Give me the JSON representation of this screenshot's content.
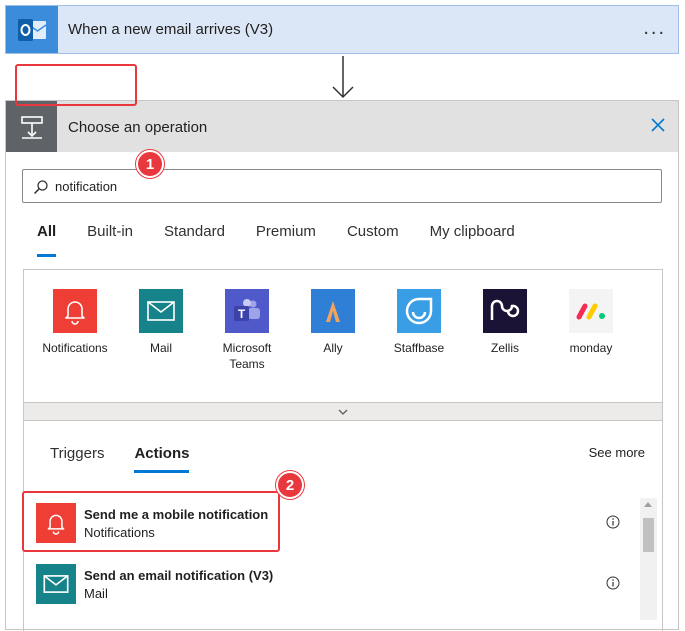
{
  "trigger": {
    "title": "When a new email arrives (V3)",
    "icon": "outlook-icon",
    "menu": "..."
  },
  "operation_panel": {
    "title": "Choose an operation",
    "search": {
      "value": "notification",
      "placeholder": ""
    },
    "tabs": [
      {
        "label": "All",
        "active": true
      },
      {
        "label": "Built-in",
        "active": false
      },
      {
        "label": "Standard",
        "active": false
      },
      {
        "label": "Premium",
        "active": false
      },
      {
        "label": "Custom",
        "active": false
      },
      {
        "label": "My clipboard",
        "active": false
      }
    ],
    "connectors": [
      {
        "label": "Notifications",
        "icon": "bell-icon",
        "color": "#ef3e36"
      },
      {
        "label": "Mail",
        "icon": "envelope-icon",
        "color": "#16838a"
      },
      {
        "label": "Microsoft Teams",
        "icon": "teams-icon",
        "color": "#5059c9"
      },
      {
        "label": "Ally",
        "icon": "ally-icon",
        "color": "#2f7fd6"
      },
      {
        "label": "Staffbase",
        "icon": "staffbase-icon",
        "color": "#3a9ee6"
      },
      {
        "label": "Zellis",
        "icon": "zellis-icon",
        "color": "#1b1335"
      },
      {
        "label": "monday",
        "icon": "monday-icon",
        "color": "#f4f4f4"
      }
    ],
    "subtabs": [
      {
        "label": "Triggers",
        "active": false
      },
      {
        "label": "Actions",
        "active": true
      }
    ],
    "see_more": "See more",
    "actions": [
      {
        "name": "Send me a mobile notification",
        "connector": "Notifications",
        "icon": "bell-icon",
        "color": "#ef3e36"
      },
      {
        "name": "Send an email notification (V3)",
        "connector": "Mail",
        "icon": "envelope-icon",
        "color": "#16838a"
      }
    ]
  },
  "annotations": [
    {
      "number": "1",
      "target": "search-input"
    },
    {
      "number": "2",
      "target": "send-mobile-notification-action"
    }
  ],
  "colors": {
    "accent": "#0078d4",
    "annotation": "#e8383d",
    "trigger_bg": "#dbe7f7"
  }
}
